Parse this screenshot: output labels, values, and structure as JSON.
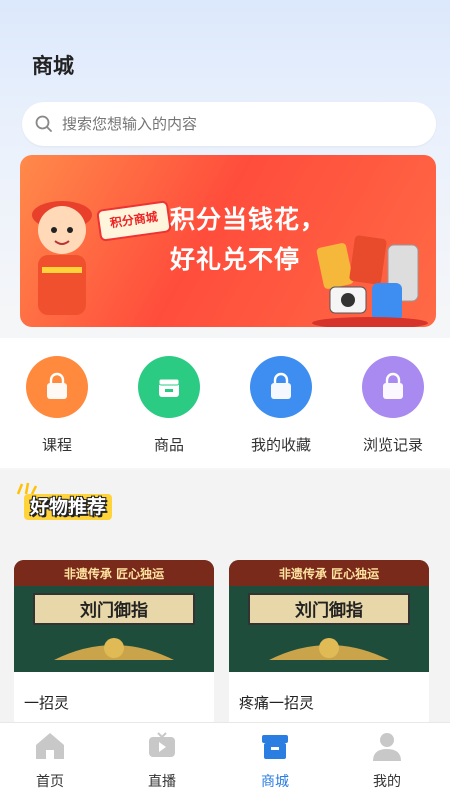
{
  "header": {
    "title": "商城"
  },
  "search": {
    "placeholder": "搜索您想输入的内容"
  },
  "banner": {
    "line1": "积分当钱花，",
    "line2": "好礼兑不停",
    "badge": "积分商城"
  },
  "quick_links": [
    {
      "label": "课程",
      "icon": "bag-icon",
      "color": "#ff8a3d"
    },
    {
      "label": "商品",
      "icon": "store-icon",
      "color": "#2ccb84"
    },
    {
      "label": "我的收藏",
      "icon": "bag-icon",
      "color": "#3d8ef0"
    },
    {
      "label": "浏览记录",
      "icon": "bag-icon",
      "color": "#a98af0"
    }
  ],
  "recommend": {
    "title": "好物推荐",
    "cards": [
      {
        "banner_top": "非遗传承  匠心独运",
        "plaque": "刘门御指",
        "title": "一招灵"
      },
      {
        "banner_top": "非遗传承  匠心独运",
        "plaque": "刘门御指",
        "title": "疼痛一招灵"
      }
    ]
  },
  "tabbar": {
    "items": [
      {
        "label": "首页",
        "icon": "home-icon"
      },
      {
        "label": "直播",
        "icon": "tv-icon"
      },
      {
        "label": "商城",
        "icon": "shop-icon",
        "active": true
      },
      {
        "label": "我的",
        "icon": "user-icon"
      }
    ],
    "active_color": "#2a7de1",
    "inactive_color": "#c8c8c8"
  }
}
